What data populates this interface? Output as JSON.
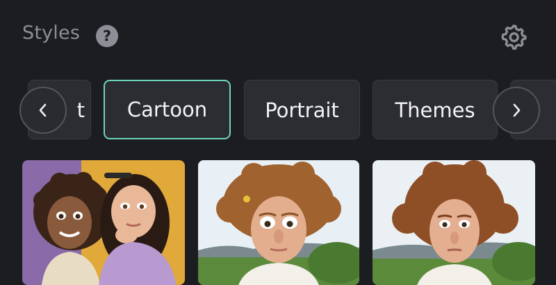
{
  "header": {
    "title": "Styles",
    "help_icon": "question-circle-icon",
    "settings_icon": "gear-icon"
  },
  "tabs": [
    {
      "label": "t",
      "partial": true
    },
    {
      "label": "Cartoon",
      "selected": true
    },
    {
      "label": "Portrait"
    },
    {
      "label": "Themes"
    },
    {
      "label": "",
      "partial": true
    }
  ],
  "nav": {
    "prev_icon": "chevron-left-icon",
    "next_icon": "chevron-right-icon"
  },
  "colors": {
    "accent": "#6fd6be",
    "background": "#1c1d21",
    "tab_bg": "#2c2d32",
    "muted_text": "#8e8f96"
  },
  "thumbnails": [
    {
      "name": "cartoon-two-girls"
    },
    {
      "name": "cartoon-curly-man-flower"
    },
    {
      "name": "cartoon-curly-man"
    }
  ]
}
